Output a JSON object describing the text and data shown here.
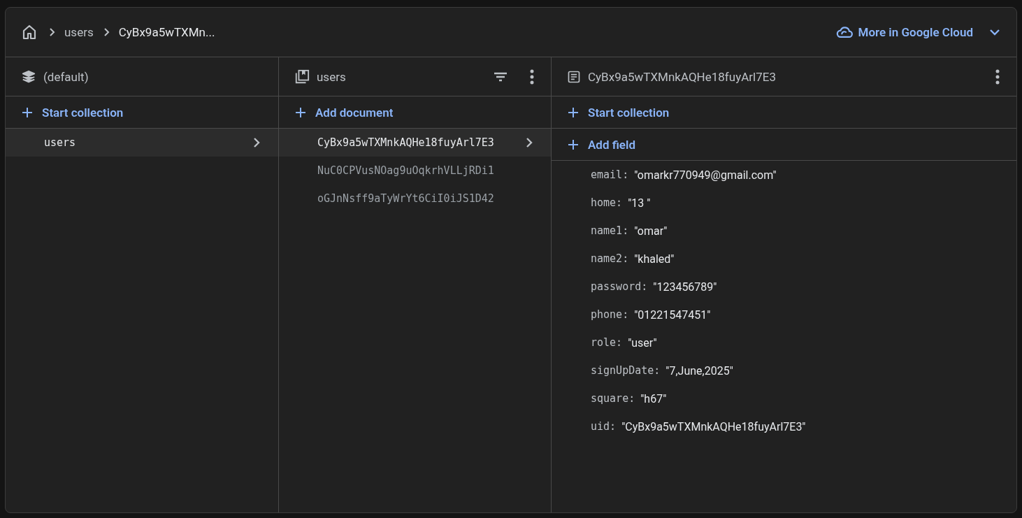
{
  "breadcrumb": {
    "items": [
      {
        "label": "users",
        "current": false
      },
      {
        "label": "CyBx9a5wTXMn...",
        "current": true
      }
    ]
  },
  "cloud_link": {
    "label": "More in Google Cloud"
  },
  "database_panel": {
    "title": "(default)",
    "action": "Start collection",
    "collections": [
      {
        "label": "users",
        "selected": true
      }
    ]
  },
  "collection_panel": {
    "title": "users",
    "action": "Add document",
    "documents": [
      {
        "label": "CyBx9a5wTXMnkAQHe18fuyArl7E3",
        "selected": true
      },
      {
        "label": "NuC0CPVusNOag9uOqkrhVLLjRDi1",
        "selected": false
      },
      {
        "label": "oGJnNsff9aTyWrYt6CiI0iJS1D42",
        "selected": false
      }
    ]
  },
  "document_panel": {
    "title": "CyBx9a5wTXMnkAQHe18fuyArl7E3",
    "actions": [
      "Start collection",
      "Add field"
    ],
    "fields": [
      {
        "key": "email:",
        "value": "\"omarkr770949@gmail.com\""
      },
      {
        "key": "home:",
        "value": "\"13 \""
      },
      {
        "key": "name1:",
        "value": "\"omar\""
      },
      {
        "key": "name2:",
        "value": "\"khaled\""
      },
      {
        "key": "password:",
        "value": "\"123456789\""
      },
      {
        "key": "phone:",
        "value": "\"01221547451\""
      },
      {
        "key": "role:",
        "value": "\"user\""
      },
      {
        "key": "signUpDate:",
        "value": "\"7,June,2025\""
      },
      {
        "key": "square:",
        "value": "\"h67\""
      },
      {
        "key": "uid:",
        "value": "\"CyBx9a5wTXMnkAQHe18fuyArl7E3\""
      }
    ]
  }
}
